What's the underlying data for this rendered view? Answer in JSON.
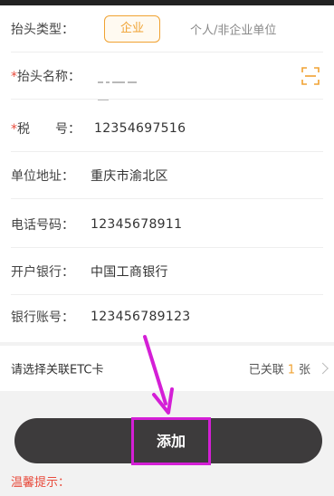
{
  "invoice_type": {
    "label": "抬头类型：",
    "options": [
      "企业",
      "个人/非企业单位"
    ],
    "selected": "企业"
  },
  "title_name": {
    "label": "抬头名称：",
    "required_mark": "*",
    "scan_icon": "scan-icon"
  },
  "tax_number": {
    "label": "税　　号：",
    "required_mark": "*",
    "value": "12354697516"
  },
  "address": {
    "label": "单位地址：",
    "value": "重庆市渝北区"
  },
  "phone": {
    "label": "电话号码：",
    "value": "12345678911"
  },
  "bank": {
    "label": "开户银行：",
    "value": "中国工商银行"
  },
  "account": {
    "label": "银行账号：",
    "value": "123456789123"
  },
  "etc": {
    "label": "请选择关联ETC卡",
    "status_prefix": "已关联",
    "count": "1",
    "status_suffix": "张"
  },
  "add_button": {
    "label": "添加"
  },
  "tip": {
    "label": "温馨提示："
  },
  "colors": {
    "accent": "#f0a232",
    "required": "#e84b3c",
    "button_bg": "#3d3b3c",
    "highlight": "#d41fd6"
  }
}
